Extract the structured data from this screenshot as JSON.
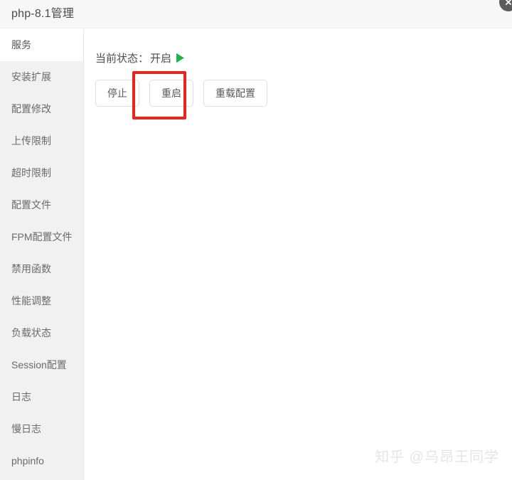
{
  "window": {
    "title": "php-8.1管理",
    "close_icon": "close-icon"
  },
  "sidebar": {
    "items": [
      {
        "label": "服务",
        "active": true
      },
      {
        "label": "安装扩展",
        "active": false
      },
      {
        "label": "配置修改",
        "active": false
      },
      {
        "label": "上传限制",
        "active": false
      },
      {
        "label": "超时限制",
        "active": false
      },
      {
        "label": "配置文件",
        "active": false
      },
      {
        "label": "FPM配置文件",
        "active": false
      },
      {
        "label": "禁用函数",
        "active": false
      },
      {
        "label": "性能调整",
        "active": false
      },
      {
        "label": "负载状态",
        "active": false
      },
      {
        "label": "Session配置",
        "active": false
      },
      {
        "label": "日志",
        "active": false
      },
      {
        "label": "慢日志",
        "active": false
      },
      {
        "label": "phpinfo",
        "active": false
      }
    ]
  },
  "main": {
    "status": {
      "label": "当前状态：",
      "value": "开启",
      "icon": "play-triangle-icon",
      "icon_color": "#22b14c"
    },
    "buttons": [
      {
        "label": "停止",
        "name": "stop-button"
      },
      {
        "label": "重启",
        "name": "restart-button"
      },
      {
        "label": "重载配置",
        "name": "reload-config-button"
      }
    ],
    "highlight": {
      "target": "重启",
      "color": "#e8251b"
    }
  },
  "watermark": {
    "text": "知乎 @乌昂王同学"
  }
}
